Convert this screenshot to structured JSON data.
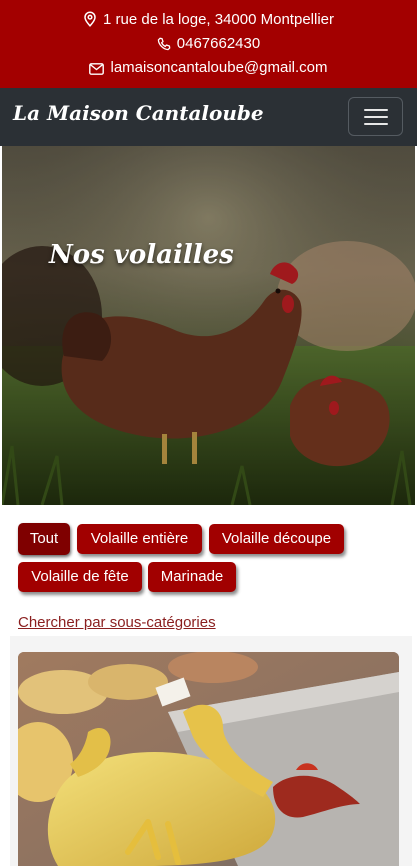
{
  "contact": {
    "address": "1 rue de la loge, 34000 Montpellier",
    "phone": "0467662430",
    "email": "lamaisoncantaloube@gmail.com"
  },
  "navbar": {
    "brand": "La Maison Cantaloube",
    "toggler_icon": "hamburger-icon"
  },
  "hero": {
    "title": "Nos volailles"
  },
  "filters": [
    {
      "label": "Tout",
      "active": true
    },
    {
      "label": "Volaille entière",
      "active": false
    },
    {
      "label": "Volaille découpe",
      "active": false
    },
    {
      "label": "Volaille de fête",
      "active": false
    },
    {
      "label": "Marinade",
      "active": false
    }
  ],
  "subcategories_link": "Chercher par sous-catégories",
  "colors": {
    "brand_red": "#a30000",
    "navbar": "#2b3035",
    "button": "#a10000",
    "button_active": "#7f0000",
    "link": "#8a1e1e"
  }
}
